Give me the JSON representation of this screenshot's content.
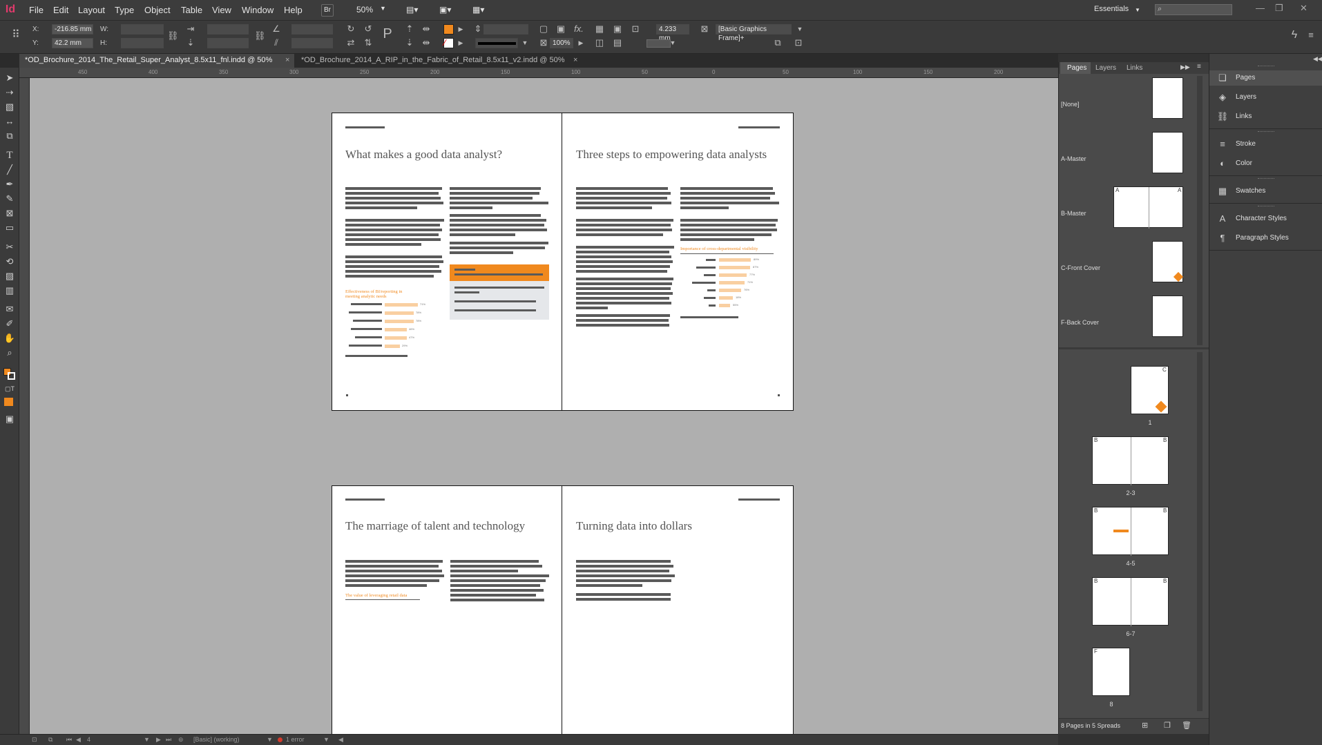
{
  "app": {
    "logo": "Id"
  },
  "menu": [
    "File",
    "Edit",
    "Layout",
    "Type",
    "Object",
    "Table",
    "View",
    "Window",
    "Help"
  ],
  "menubar_extra": {
    "bridge": "Br",
    "zoom": "50%",
    "workspace": "Essentials",
    "search_placeholder": ""
  },
  "control": {
    "x_label": "X:",
    "x_value": "-216.85 mm",
    "y_label": "Y:",
    "y_value": "42.2 mm",
    "w_label": "W:",
    "h_label": "H:",
    "stroke_weight": "4.233 mm",
    "opacity": "100%",
    "object_style": "[Basic Graphics Frame]+"
  },
  "tabs": [
    {
      "label": "*OD_Brochure_2014_The_Retail_Super_Analyst_8.5x11_fnl.indd @ 50%",
      "active": true
    },
    {
      "label": "*OD_Brochure_2014_A_RIP_in_the_Fabric_of_Retail_8.5x11_v2.indd @ 50%",
      "active": false
    }
  ],
  "ruler_h": [
    "450",
    "400",
    "350",
    "300",
    "250",
    "200",
    "150",
    "100",
    "50",
    "0",
    "50",
    "100",
    "150",
    "200",
    "250"
  ],
  "spread1": {
    "left_title": "What makes a good data analyst?",
    "right_title": "Three steps to empowering data analysts",
    "left_chart_title": "Effectiveness of BI/reporting in meeting analytic needs",
    "left_chart_values": [
      "71%",
      "78%",
      "78%",
      "46%",
      "47%",
      "29%"
    ],
    "right_chart_title": "Importance of cross-departmental visibility",
    "right_chart_values": [
      "89%",
      "87%",
      "77%",
      "71%",
      "76%",
      "18%",
      "55%"
    ]
  },
  "spread2": {
    "left_title": "The marriage of talent and technology",
    "right_title": "Turning data into dollars",
    "left_subhead": "The value of leveraging retail data"
  },
  "pages_panel": {
    "tabs": [
      "Pages",
      "Layers",
      "Links"
    ],
    "masters": [
      "[None]",
      "A-Master",
      "B-Master",
      "C-Front Cover",
      "F-Back Cover"
    ],
    "page_labels": [
      "1",
      "2-3",
      "4-5",
      "6-7",
      "8"
    ],
    "master_letters": [
      "C",
      "B",
      "B",
      "B",
      "B",
      "B",
      "B",
      "F"
    ],
    "footer": "8 Pages in 5 Spreads"
  },
  "dock": [
    "Pages",
    "Layers",
    "Links",
    "Stroke",
    "Color",
    "Swatches",
    "Character Styles",
    "Paragraph Styles"
  ],
  "status": {
    "page": "4",
    "preflight_profile": "[Basic] (working)",
    "errors": "1 error"
  },
  "colors": {
    "accent": "#f0891e",
    "accent_light": "#f9cfa1"
  }
}
